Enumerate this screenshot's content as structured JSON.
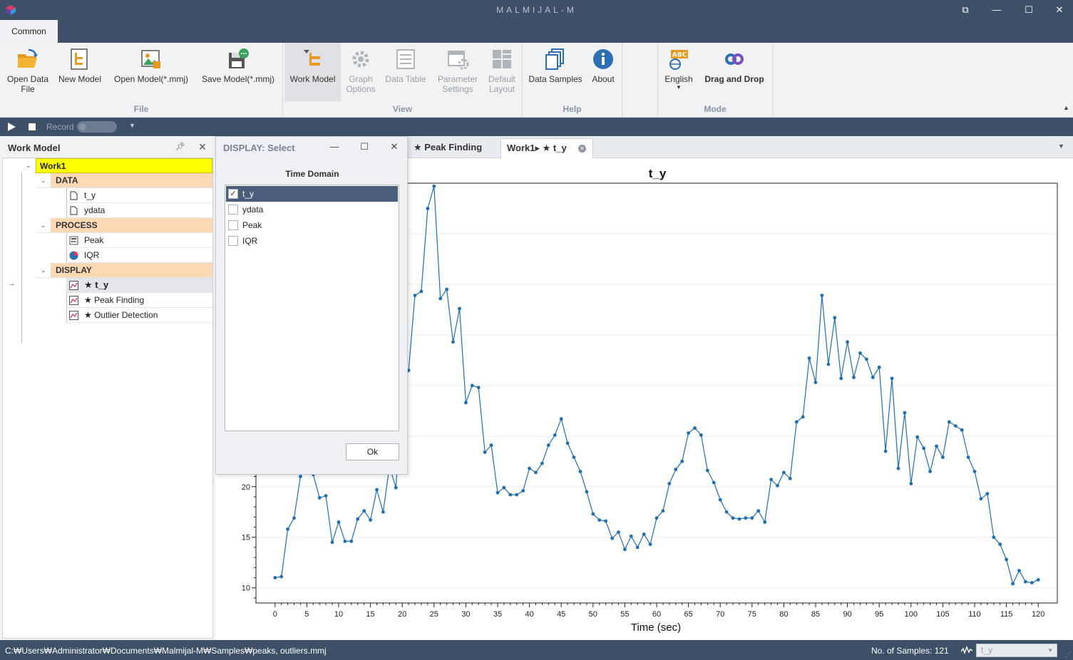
{
  "window": {
    "title": "MALMIJAL-M",
    "buttons": [
      "⧉",
      "—",
      "☐",
      "✕"
    ]
  },
  "ribbon": {
    "tabs": [
      "Common"
    ],
    "groups": {
      "file": {
        "label": "File",
        "buttons": [
          {
            "label": "Open Data File",
            "icon": "folder-open-icon"
          },
          {
            "label": "New Model",
            "icon": "new-model-icon"
          },
          {
            "label": "Open Model(*.mmj)",
            "icon": "open-model-icon"
          },
          {
            "label": "Save Model(*.mmj)",
            "icon": "save-model-icon"
          }
        ]
      },
      "view": {
        "label": "View",
        "buttons": [
          {
            "label": "Work Model",
            "icon": "work-model-icon"
          },
          {
            "label": "Graph Options",
            "icon": "graph-options-icon"
          },
          {
            "label": "Data Table",
            "icon": "data-table-icon"
          },
          {
            "label": "Parameter Settings",
            "icon": "parameter-settings-icon"
          },
          {
            "label": "Default Layout",
            "icon": "default-layout-icon"
          }
        ]
      },
      "help": {
        "label": "Help",
        "buttons": [
          {
            "label": "Data Samples",
            "icon": "data-samples-icon"
          },
          {
            "label": "About",
            "icon": "info-icon"
          }
        ]
      },
      "mode": {
        "label": "Mode",
        "buttons": [
          {
            "label": "English",
            "icon": "language-icon",
            "badge": "ABC"
          },
          {
            "label": "Drag and Drop",
            "icon": "drag-drop-icon"
          }
        ]
      }
    }
  },
  "recordbar": {
    "record_label": "Record"
  },
  "work_model": {
    "title": "Work Model",
    "root": "Work1",
    "sections": [
      {
        "name": "DATA",
        "items": [
          {
            "label": "t_y",
            "icon": "document-icon"
          },
          {
            "label": "ydata",
            "icon": "document-icon"
          }
        ]
      },
      {
        "name": "PROCESS",
        "items": [
          {
            "label": "Peak",
            "icon": "calculator-icon"
          },
          {
            "label": "IQR",
            "icon": "pie-chart-icon"
          }
        ]
      },
      {
        "name": "DISPLAY",
        "items": [
          {
            "label": "★ t_y",
            "icon": "line-chart-icon"
          },
          {
            "label": "★ Peak Finding",
            "icon": "line-chart-icon"
          },
          {
            "label": "★ Outlier Detection",
            "icon": "line-chart-icon"
          }
        ]
      }
    ]
  },
  "dialog": {
    "title": "DISPLAY: Select",
    "subtitle": "Time Domain",
    "items": [
      {
        "label": "t_y",
        "checked": true
      },
      {
        "label": "ydata",
        "checked": false
      },
      {
        "label": "Peak",
        "checked": false
      },
      {
        "label": "IQR",
        "checked": false
      }
    ],
    "ok_label": "Ok"
  },
  "doc_tabs": [
    {
      "label": "★ Peak Finding",
      "active": false
    },
    {
      "label": "Work1▸ ★ t_y",
      "active": true
    }
  ],
  "chart_data": {
    "type": "line",
    "title": "t_y",
    "xlabel": "Time (sec)",
    "ylabel": "",
    "xlim": [
      -3,
      123
    ],
    "ylim": [
      8.5,
      50
    ],
    "xticks": [
      0,
      5,
      10,
      15,
      20,
      25,
      30,
      35,
      40,
      45,
      50,
      55,
      60,
      65,
      70,
      75,
      80,
      85,
      90,
      95,
      100,
      105,
      110,
      115,
      120
    ],
    "yticks": [
      10,
      15,
      20
    ],
    "color": "#1f6fae",
    "x_start": 0,
    "x_step": 1,
    "values": [
      11.0,
      11.1,
      15.8,
      16.9,
      21.0,
      22.4,
      21.2,
      18.9,
      19.1,
      14.5,
      16.5,
      14.6,
      14.6,
      16.8,
      17.6,
      16.7,
      19.7,
      17.5,
      22.0,
      19.9,
      30.1,
      31.5,
      38.9,
      39.3,
      47.5,
      49.7,
      38.6,
      39.5,
      34.3,
      37.6,
      28.3,
      30.0,
      29.8,
      23.4,
      24.1,
      19.4,
      19.9,
      19.2,
      19.2,
      19.6,
      21.8,
      21.4,
      22.3,
      24.1,
      25.1,
      26.7,
      24.3,
      22.9,
      21.5,
      19.5,
      17.3,
      16.7,
      16.6,
      14.9,
      15.5,
      13.8,
      15.1,
      14.0,
      15.3,
      14.3,
      16.9,
      17.6,
      20.3,
      21.7,
      22.5,
      25.3,
      25.8,
      25.1,
      21.6,
      20.4,
      18.7,
      17.5,
      16.9,
      16.8,
      16.9,
      16.9,
      17.6,
      16.5,
      20.7,
      20.1,
      21.4,
      20.8,
      26.4,
      26.9,
      32.7,
      30.3,
      38.9,
      32.1,
      36.7,
      30.7,
      34.3,
      30.8,
      33.2,
      32.6,
      30.8,
      31.8,
      23.5,
      30.7,
      21.8,
      27.3,
      20.3,
      24.9,
      23.8,
      21.5,
      24.0,
      22.9,
      26.4,
      26.0,
      25.6,
      22.9,
      21.5,
      18.8,
      19.3,
      15.0,
      14.3,
      12.8,
      10.4,
      11.7,
      10.6,
      10.5,
      10.8
    ]
  },
  "statusbar": {
    "path": "C:₩Users₩Administrator₩Documents₩Malmijal-M₩Samples₩peaks, outliers.mmj",
    "samples": "No. of Samples: 121",
    "selector_value": "t_y"
  }
}
